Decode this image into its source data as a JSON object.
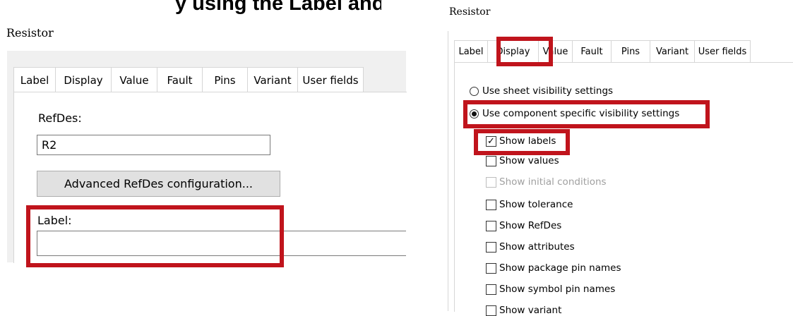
{
  "cropped_heading": "y using the Label and Display tabs, as",
  "left_dialog": {
    "title": "Resistor",
    "tabs": [
      "Label",
      "Display",
      "Value",
      "Fault",
      "Pins",
      "Variant",
      "User fields"
    ],
    "active_tab": "Label",
    "refdes_label": "RefDes:",
    "refdes_value": "R2",
    "advanced_button": "Advanced RefDes configuration...",
    "label_label": "Label:",
    "label_value": ""
  },
  "right_dialog": {
    "title": "Resistor",
    "tabs": [
      "Label",
      "Display",
      "Value",
      "Fault",
      "Pins",
      "Variant",
      "User fields"
    ],
    "active_tab": "Display",
    "radio_sheet": "Use sheet visibility settings",
    "radio_component": "Use component specific visibility settings",
    "selected_radio": "component",
    "checkboxes": [
      {
        "label": "Show labels",
        "checked": true,
        "enabled": true
      },
      {
        "label": "Show values",
        "checked": false,
        "enabled": true
      },
      {
        "label": "Show initial conditions",
        "checked": false,
        "enabled": false
      },
      {
        "label": "Show tolerance",
        "checked": false,
        "enabled": true
      },
      {
        "label": "Show RefDes",
        "checked": false,
        "enabled": true
      },
      {
        "label": "Show attributes",
        "checked": false,
        "enabled": true
      },
      {
        "label": "Show package pin names",
        "checked": false,
        "enabled": true
      },
      {
        "label": "Show symbol pin names",
        "checked": false,
        "enabled": true
      },
      {
        "label": "Show variant",
        "checked": false,
        "enabled": true
      }
    ]
  },
  "colors": {
    "highlight": "#c0141c",
    "panel_bg": "#f0f0f0",
    "tab_border": "#d6d6d6"
  }
}
